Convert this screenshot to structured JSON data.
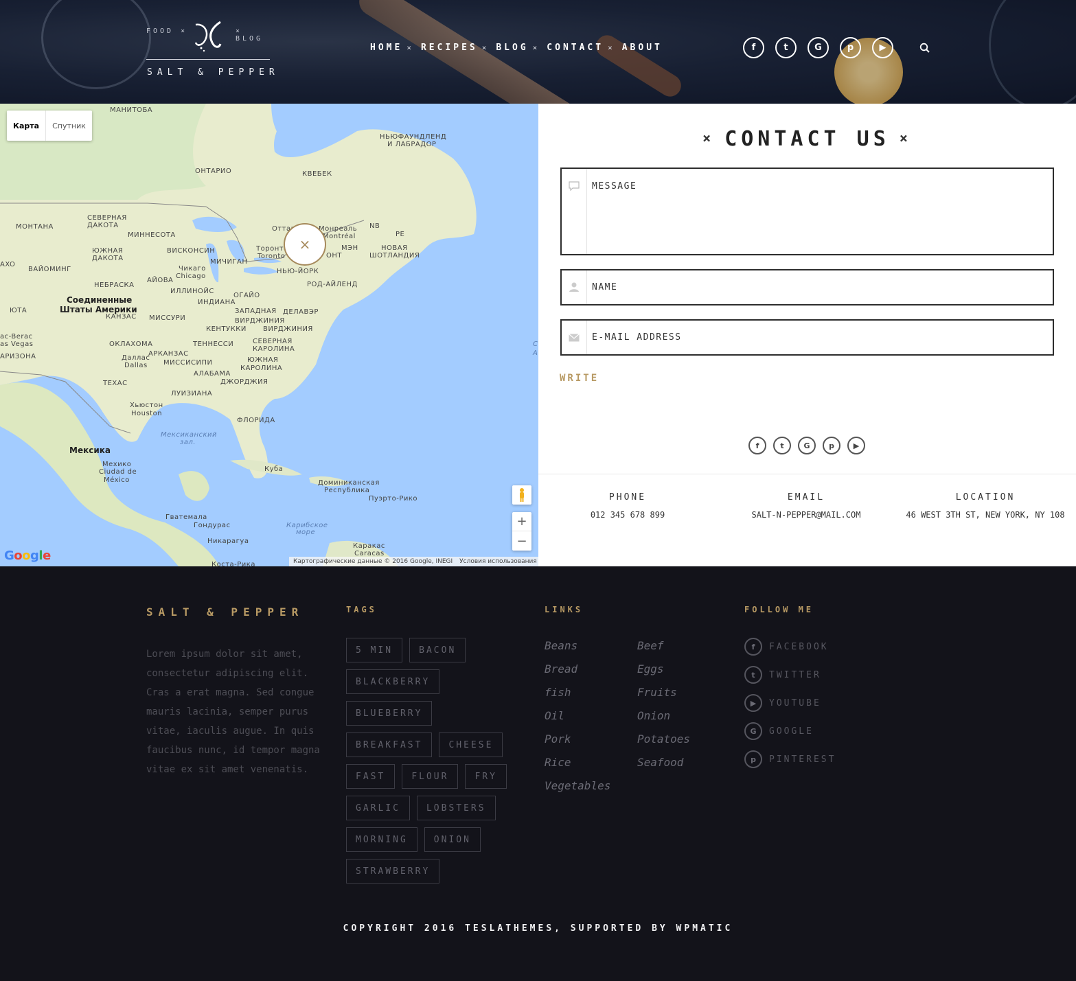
{
  "header": {
    "logo": {
      "left_text": "FOOD ×",
      "right_text": "× BLOG",
      "name": "SALT & PEPPER"
    },
    "nav": [
      {
        "label": "HOME",
        "sep": "×"
      },
      {
        "label": "RECIPES",
        "sep": "×"
      },
      {
        "label": "BLOG",
        "sep": "×"
      },
      {
        "label": "CONTACT",
        "sep": "×"
      },
      {
        "label": "ABOUT",
        "sep": ""
      }
    ],
    "social": [
      {
        "icon": "facebook-icon",
        "glyph": "f"
      },
      {
        "icon": "twitter-icon",
        "glyph": "t"
      },
      {
        "icon": "google-icon",
        "glyph": "G"
      },
      {
        "icon": "pinterest-icon",
        "glyph": "p"
      },
      {
        "icon": "youtube-icon",
        "glyph": "▶"
      }
    ],
    "search_icon": "search-icon"
  },
  "map": {
    "type_map": "Карта",
    "type_satellite": "Спутник",
    "marker_glyph": "×",
    "zoom_in": "+",
    "zoom_out": "−",
    "google": "Google",
    "attribution": "Картографические данные © 2016 Google, INEGI",
    "terms": "Условия использования",
    "labels": [
      {
        "text": "МАНИТОБА",
        "kind": ""
      },
      {
        "text": "ОНТАРИО",
        "kind": ""
      },
      {
        "text": "КВЕБЕК",
        "kind": ""
      },
      {
        "text": "НЬЮФАУНДЛЕНД",
        "kind": ""
      },
      {
        "text": "И ЛАБРАДОР",
        "kind": ""
      },
      {
        "text": "МОНТАНА",
        "kind": ""
      },
      {
        "text": "СЕВЕРНАЯ",
        "kind": ""
      },
      {
        "text": "ДАКОТА",
        "kind": ""
      },
      {
        "text": "МИННЕСОТА",
        "kind": ""
      },
      {
        "text": "ЮЖНАЯ",
        "kind": ""
      },
      {
        "text": "ДАКОТА",
        "kind": ""
      },
      {
        "text": "ВИСКОНСИН",
        "kind": ""
      },
      {
        "text": "ВАЙОМИНГ",
        "kind": ""
      },
      {
        "text": "МИЧИГАН",
        "kind": ""
      },
      {
        "text": "Чикаго",
        "kind": ""
      },
      {
        "text": "Chicago",
        "kind": ""
      },
      {
        "text": "Торонто",
        "kind": ""
      },
      {
        "text": "Toronto",
        "kind": ""
      },
      {
        "text": "Оттава",
        "kind": ""
      },
      {
        "text": "Монреаль",
        "kind": ""
      },
      {
        "text": "Montréal",
        "kind": ""
      },
      {
        "text": "NB",
        "kind": ""
      },
      {
        "text": "PE",
        "kind": ""
      },
      {
        "text": "МЭН",
        "kind": ""
      },
      {
        "text": "НОВАЯ",
        "kind": ""
      },
      {
        "text": "ШОТЛАНДИЯ",
        "kind": ""
      },
      {
        "text": "ОНТ",
        "kind": ""
      },
      {
        "text": "НЬЮ-ЙОРК",
        "kind": ""
      },
      {
        "text": "НЕБРАСКА",
        "kind": ""
      },
      {
        "text": "АЙОВА",
        "kind": ""
      },
      {
        "text": "ИЛЛИНОЙС",
        "kind": ""
      },
      {
        "text": "ОГАЙО",
        "kind": ""
      },
      {
        "text": "РОД-АЙЛЕНД",
        "kind": ""
      },
      {
        "text": "Соединенные",
        "kind": "big"
      },
      {
        "text": "Штаты Америки",
        "kind": "big"
      },
      {
        "text": "ИНДИАНА",
        "kind": ""
      },
      {
        "text": "ЮТА",
        "kind": ""
      },
      {
        "text": "КАНЗАС",
        "kind": ""
      },
      {
        "text": "МИССУРИ",
        "kind": ""
      },
      {
        "text": "ЗАПАДНАЯ",
        "kind": ""
      },
      {
        "text": "ВИРДЖИНИЯ",
        "kind": ""
      },
      {
        "text": "ДЕЛАВЭР",
        "kind": ""
      },
      {
        "text": "КЕНТУККИ",
        "kind": ""
      },
      {
        "text": "ВИРДЖИНИЯ",
        "kind": ""
      },
      {
        "text": "ac-Berac",
        "kind": ""
      },
      {
        "text": "as Vegas",
        "kind": ""
      },
      {
        "text": "ОКЛАХОМА",
        "kind": ""
      },
      {
        "text": "ТЕННЕССИ",
        "kind": ""
      },
      {
        "text": "СЕВЕРНАЯ",
        "kind": ""
      },
      {
        "text": "КАРОЛИНА",
        "kind": ""
      },
      {
        "text": "АРИЗОНА",
        "kind": ""
      },
      {
        "text": "АРКАНЗАС",
        "kind": ""
      },
      {
        "text": "Даллас",
        "kind": ""
      },
      {
        "text": "Dallas",
        "kind": ""
      },
      {
        "text": "МИССИСИПИ",
        "kind": ""
      },
      {
        "text": "ЮЖНАЯ",
        "kind": ""
      },
      {
        "text": "КАРОЛИНА",
        "kind": ""
      },
      {
        "text": "АЛАБАМА",
        "kind": ""
      },
      {
        "text": "ДЖОРДЖИЯ",
        "kind": ""
      },
      {
        "text": "ТЕХАС",
        "kind": ""
      },
      {
        "text": "ЛУИЗИАНА",
        "kind": ""
      },
      {
        "text": "Хьюстон",
        "kind": ""
      },
      {
        "text": "Houston",
        "kind": ""
      },
      {
        "text": "ФЛОРИДА",
        "kind": ""
      },
      {
        "text": "Мексиканский",
        "kind": "sea"
      },
      {
        "text": "зал.",
        "kind": "sea"
      },
      {
        "text": "Мексика",
        "kind": "big"
      },
      {
        "text": "Мехико",
        "kind": ""
      },
      {
        "text": "Ciudad de",
        "kind": ""
      },
      {
        "text": "México",
        "kind": ""
      },
      {
        "text": "Куба",
        "kind": ""
      },
      {
        "text": "Доминиканская",
        "kind": ""
      },
      {
        "text": "Республика",
        "kind": ""
      },
      {
        "text": "Пуэрто-Рико",
        "kind": ""
      },
      {
        "text": "Гватемала",
        "kind": ""
      },
      {
        "text": "Гондурас",
        "kind": ""
      },
      {
        "text": "Карибское",
        "kind": "sea"
      },
      {
        "text": "море",
        "kind": "sea"
      },
      {
        "text": "Никарагуа",
        "kind": ""
      },
      {
        "text": "Каракас",
        "kind": ""
      },
      {
        "text": "Caracas",
        "kind": ""
      },
      {
        "text": "Коста-Рика",
        "kind": ""
      },
      {
        "text": "AH",
        "kind": ""
      },
      {
        "text": "AXO",
        "kind": ""
      },
      {
        "text": "С",
        "kind": "sea"
      },
      {
        "text": "А",
        "kind": "sea"
      }
    ]
  },
  "contact": {
    "title": "CONTACT US",
    "title_deco": "×",
    "message_placeholder": "MESSAGE",
    "name_placeholder": "NAME",
    "email_placeholder": "E-MAIL ADDRESS",
    "write_label": "WRITE",
    "social": [
      {
        "icon": "facebook-icon",
        "glyph": "f"
      },
      {
        "icon": "twitter-icon",
        "glyph": "t"
      },
      {
        "icon": "google-icon",
        "glyph": "G"
      },
      {
        "icon": "pinterest-icon",
        "glyph": "p"
      },
      {
        "icon": "youtube-icon",
        "glyph": "▶"
      }
    ],
    "info": [
      {
        "label": "PHONE",
        "value": "012 345 678 899"
      },
      {
        "label": "EMAIL",
        "value": "SALT-N-PEPPER@MAIL.COM"
      },
      {
        "label": "LOCATION",
        "value": "46 WEST 3TH ST, NEW YORK, NY 108"
      }
    ]
  },
  "footer": {
    "brand": "SALT & PEPPER",
    "about": "Lorem ipsum dolor sit amet, consectetur adipiscing elit. Cras a erat magna. Sed congue mauris lacinia, semper purus vitae, iaculis augue. In quis faucibus nunc, id tempor magna vitae ex sit amet venenatis.",
    "tags_heading": "TAGS",
    "tags": [
      "5 MIN",
      "BACON",
      "BLACKBERRY",
      "BLUEBERRY",
      "BREAKFAST",
      "CHEESE",
      "FAST",
      "FLOUR",
      "FRY",
      "GARLIC",
      "LOBSTERS",
      "MORNING",
      "ONION",
      "STRAWBERRY"
    ],
    "links_heading": "LINKS",
    "links": [
      "Beans",
      "Beef",
      "Bread",
      "Eggs",
      "fish",
      "Fruits",
      "Oil",
      "Onion",
      "Pork",
      "Potatoes",
      "Rice",
      "Seafood",
      "Vegetables"
    ],
    "follow_heading": "FOLLOW ME",
    "follow": [
      {
        "icon": "facebook-icon",
        "glyph": "f",
        "label": "FACEBOOK"
      },
      {
        "icon": "twitter-icon",
        "glyph": "t",
        "label": "TWITTER"
      },
      {
        "icon": "youtube-icon",
        "glyph": "▶",
        "label": "YOUTUBE"
      },
      {
        "icon": "google-icon",
        "glyph": "G",
        "label": "GOOGLE"
      },
      {
        "icon": "pinterest-icon",
        "glyph": "p",
        "label": "PINTEREST"
      }
    ],
    "copyright": "COPYRIGHT 2016 TESLATHEMES, SUPPORTED BY WPMATIC"
  },
  "colors": {
    "accent": "#b89a64",
    "dark": "#13131a",
    "water": "#a3ccff",
    "land": "#e9edd0"
  }
}
